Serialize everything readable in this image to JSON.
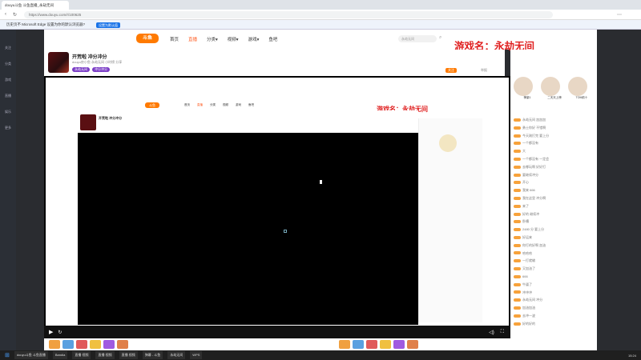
{
  "browser": {
    "tab_title": "douyu斗鱼 斗鱼直播_永劫无间",
    "url": "https://www.douyu.com/r/100625",
    "infobar_text": "历史页不 Microsoft Edge 设置为你的默认浏览器?",
    "infobar_button": "设置为默认值"
  },
  "rail": {
    "items": [
      "关注",
      "分类",
      "游戏",
      "直播",
      "娱乐",
      "更多"
    ]
  },
  "site": {
    "logo": "斗鱼",
    "nav": [
      "首页",
      "直播",
      "分类▾",
      "视频▾",
      "游戏▾",
      "鱼吧"
    ],
    "search_placeholder": "永劫无间",
    "watermark": "游戏名：永劫无间"
  },
  "room": {
    "title": "开荒啦 冲分冲分",
    "meta": "douyu房小鱼  永劫无间  小时榜  分享",
    "follow": "关注",
    "tags": [
      "永劫无间",
      "冲分冲分"
    ],
    "report": "举报"
  },
  "inner": {
    "logo": "斗鱼",
    "nav": [
      "首页",
      "直播",
      "分类",
      "视频",
      "游戏",
      "鱼吧"
    ],
    "title": "开荒啦 冲分冲分",
    "watermark": "游戏名：永劫无间"
  },
  "chat": {
    "rank_labels": [
      "神豪1",
      "二天天上榜",
      "TOM前十"
    ],
    "messages": [
      "永劫无间 加加加",
      "勇士你好 不错啊",
      "今天刚打完 要上分",
      "一个都没有",
      "大",
      "一个都没有 一定会",
      "去哪玩啊 好好打",
      "要继续冲分",
      "开心",
      "我来 666",
      "我在这里 冲分啊",
      "来了",
      "好的 继续冲",
      "卧槽",
      "2480 分 要上分",
      "好运来",
      "你打的好啊 加油",
      "哈哈哈",
      "一打就输",
      "又加油了",
      "666",
      "牛逼了",
      "冲冲冲",
      "永劫无间 冲分",
      "加油加油",
      "去冲一波",
      "好的好的"
    ]
  },
  "taskbar": {
    "items": [
      "douyu斗鱼 斗鱼直播",
      "Bandia",
      "直播 视频",
      "直播 视频",
      "直播 视频",
      "弹幕 - 斗鱼",
      "永劫无间",
      "WPS"
    ],
    "time": "15:24"
  }
}
